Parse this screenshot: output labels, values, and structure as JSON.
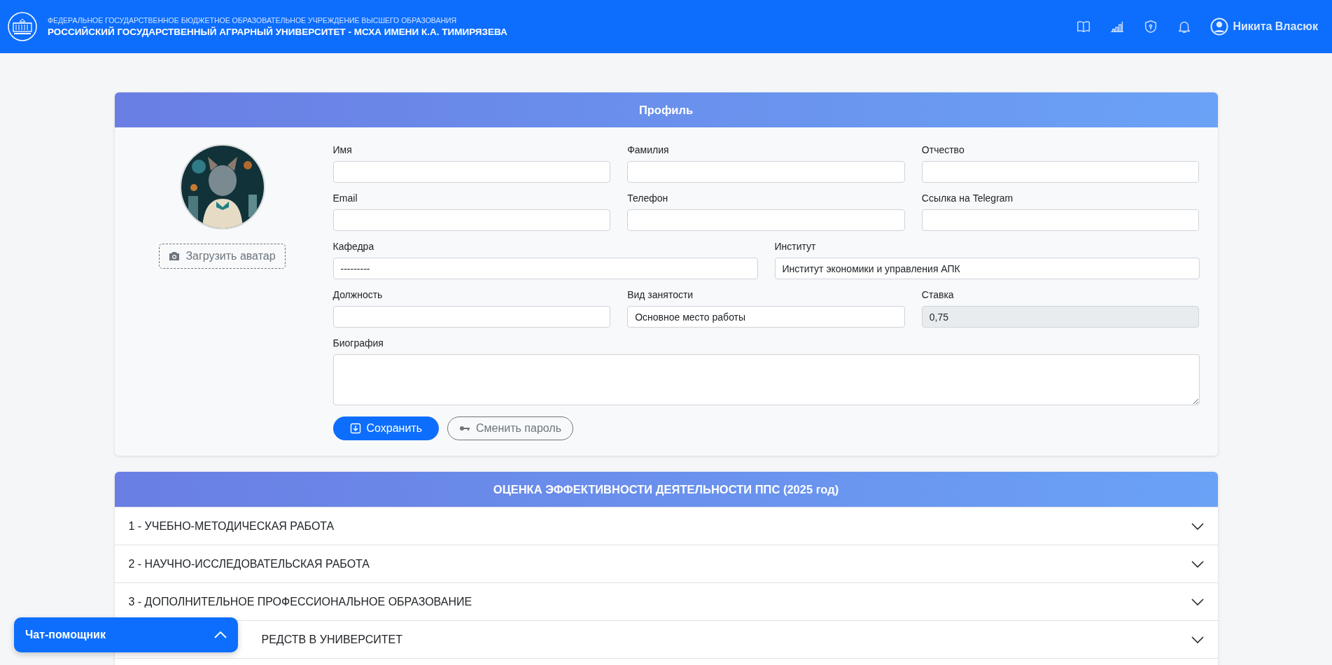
{
  "header": {
    "org_line": "ФЕДЕРАЛЬНОЕ ГОСУДАРСТВЕННОЕ БЮДЖЕТНОЕ ОБРАЗОВАТЕЛЬНОЕ УЧРЕЖДЕНИЕ ВЫСШЕГО ОБРАЗОВАНИЯ",
    "university": "РОССИЙСКИЙ ГОСУДАРСТВЕННЫЙ АГРАРНЫЙ УНИВЕРСИТЕТ - МСХА ИМЕНИ К.А. ТИМИРЯЗЕВА",
    "user_name": "Никита Власюк"
  },
  "profile": {
    "title": "Профиль",
    "upload_button": "Загрузить аватар",
    "lines": [
      {
        "fields": [
          {
            "label": "Имя",
            "disabled": false
          },
          {
            "label": "Фамилия",
            "disabled": false
          },
          {
            "label": "Отчество",
            "disabled": false
          }
        ]
      },
      {
        "fields": [
          {
            "label": "Email",
            "disabled": false
          },
          {
            "label": "Телефон",
            "disabled": false
          },
          {
            "label": "Ссылка на Telegram",
            "disabled": false
          }
        ]
      },
      {
        "fields": [
          {
            "label": "Кафедра",
            "value": "---------",
            "disabled": false
          },
          {
            "label": "Институт",
            "value": "Институт экономики и управления АПК",
            "disabled": false
          }
        ]
      },
      {
        "fields": [
          {
            "label": "Должность",
            "disabled": false
          },
          {
            "label": "Вид занятости",
            "value": "Основное место работы",
            "disabled": false
          },
          {
            "label": "Ставка",
            "value": "0,75",
            "disabled": true
          }
        ]
      }
    ],
    "biography": {
      "label": "Биография"
    },
    "save_button": "Сохранить",
    "change_password_button": "Сменить пароль"
  },
  "evaluation": {
    "title": "ОЦЕНКА ЭФФЕКТИВНОСТИ ДЕЯТЕЛЬНОСТИ ППС (2025 год)",
    "sections": [
      {
        "label": "1 - УЧЕБНО-МЕТОДИЧЕСКАЯ РАБОТА",
        "expanded": false,
        "covered": false
      },
      {
        "label": "2 - НАУЧНО-ИССЛЕДОВАТЕЛЬСКАЯ РАБОТА",
        "expanded": false,
        "covered": false
      },
      {
        "label": "3 - ДОПОЛНИТЕЛЬНОЕ ПРОФЕССИОНАЛЬНОЕ ОБРАЗОВАНИЕ",
        "expanded": false,
        "covered": false
      },
      {
        "label": "РЕДСТВ В УНИВЕРСИТЕТ",
        "expanded": false,
        "covered": true
      }
    ]
  },
  "chat": {
    "title": "Чат-помощник",
    "expanded": false
  }
}
